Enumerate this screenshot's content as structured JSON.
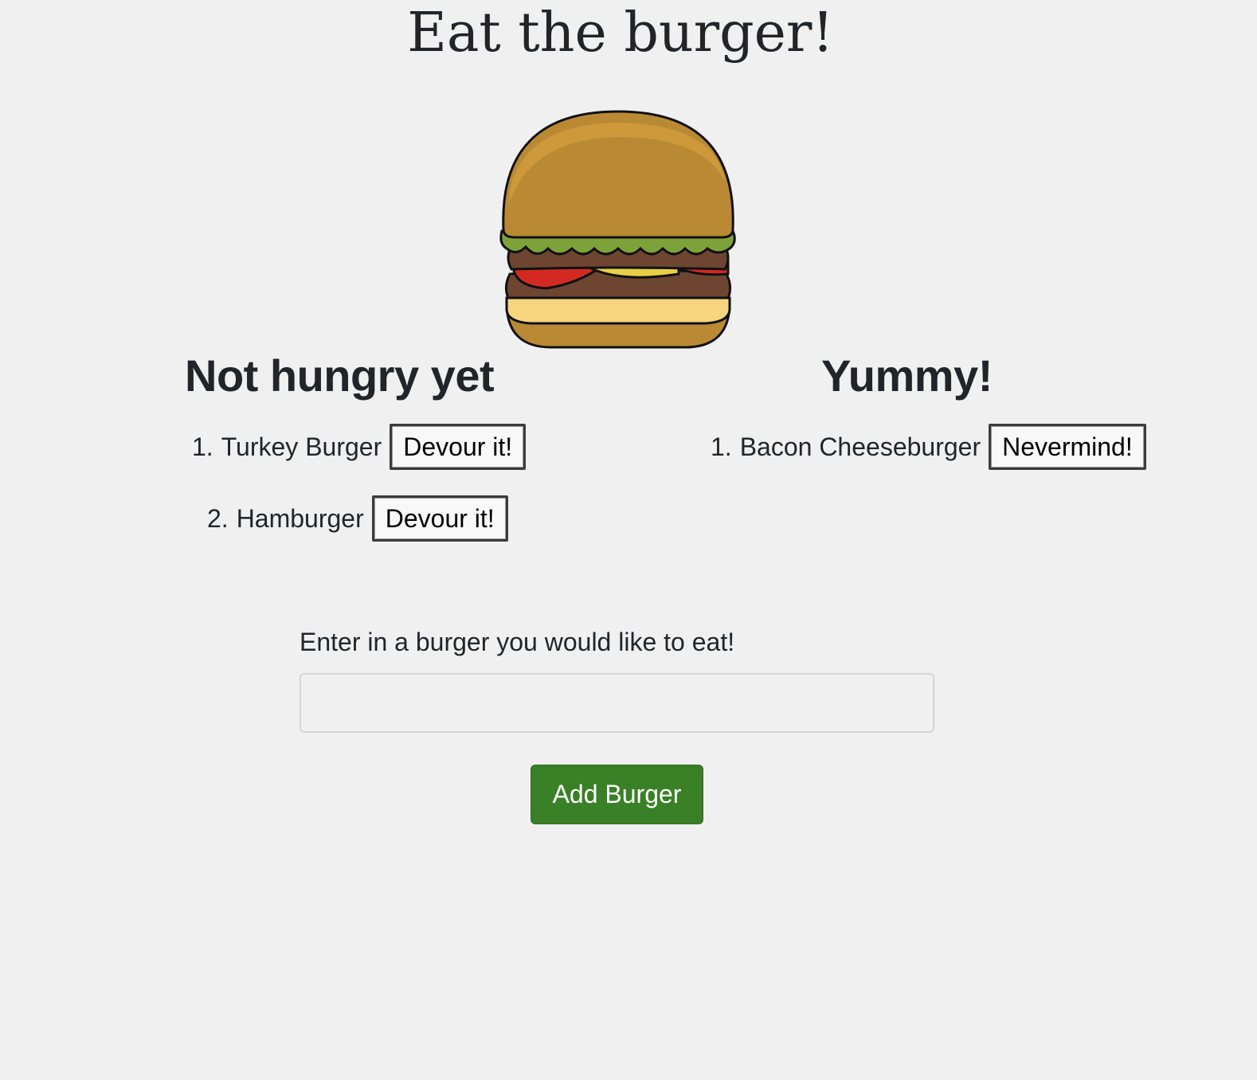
{
  "page": {
    "title": "Eat the burger!"
  },
  "hero": {
    "image": "burger-illustration",
    "colors": {
      "bun": "#b98a33",
      "bun_highlight": "#cf9a3c",
      "lettuce": "#7ea23a",
      "patty": "#6e4530",
      "tomato": "#d22a22",
      "cheese": "#e6cf45",
      "bottom_bun_inner": "#f7d57e"
    }
  },
  "not_eaten": {
    "heading": "Not hungry yet",
    "items": [
      {
        "number": "1.",
        "name": "Turkey Burger",
        "button": "Devour it!"
      },
      {
        "number": "2.",
        "name": "Hamburger",
        "button": "Devour it!"
      }
    ]
  },
  "eaten": {
    "heading": "Yummy!",
    "items": [
      {
        "number": "1.",
        "name": "Bacon Cheeseburger",
        "button": "Nevermind!"
      }
    ]
  },
  "form": {
    "label": "Enter in a burger you would like to eat!",
    "input_value": "",
    "input_placeholder": "",
    "submit_label": "Add Burger",
    "submit_color": "#3a8026"
  }
}
